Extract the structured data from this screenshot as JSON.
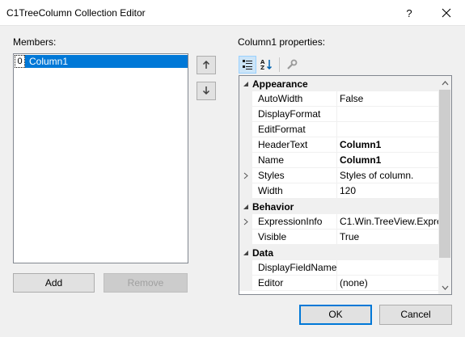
{
  "window": {
    "title": "C1TreeColumn Collection Editor",
    "help_glyph": "?",
    "close_glyph": "✕"
  },
  "members": {
    "label": "Members:",
    "items": [
      {
        "index": "0",
        "name": "Column1",
        "selected": true
      }
    ],
    "up_icon": "arrow-up-icon",
    "down_icon": "arrow-down-icon",
    "add_label": "Add",
    "remove_label": "Remove"
  },
  "properties": {
    "label": "Column1 properties:",
    "toolbar": [
      "categorized-icon",
      "alphabetical-icon",
      "property-pages-icon"
    ],
    "categories": [
      {
        "name": "Appearance",
        "rows": [
          {
            "name": "AutoWidth",
            "value": "False",
            "expandable": false,
            "bold": false
          },
          {
            "name": "DisplayFormat",
            "value": "",
            "expandable": false,
            "bold": false
          },
          {
            "name": "EditFormat",
            "value": "",
            "expandable": false,
            "bold": false
          },
          {
            "name": "HeaderText",
            "value": "Column1",
            "expandable": false,
            "bold": true
          },
          {
            "name": "Name",
            "value": "Column1",
            "expandable": false,
            "bold": true
          },
          {
            "name": "Styles",
            "value": "Styles of column.",
            "expandable": true,
            "bold": false
          },
          {
            "name": "Width",
            "value": "120",
            "expandable": false,
            "bold": false
          }
        ]
      },
      {
        "name": "Behavior",
        "rows": [
          {
            "name": "ExpressionInfo",
            "value": "C1.Win.TreeView.Expres",
            "expandable": true,
            "bold": false
          },
          {
            "name": "Visible",
            "value": "True",
            "expandable": false,
            "bold": false
          }
        ]
      },
      {
        "name": "Data",
        "rows": [
          {
            "name": "DisplayFieldName",
            "value": "",
            "expandable": false,
            "bold": false
          },
          {
            "name": "Editor",
            "value": "(none)",
            "expandable": false,
            "bold": false
          }
        ]
      }
    ]
  },
  "buttons": {
    "ok": "OK",
    "cancel": "Cancel"
  },
  "colors": {
    "selection": "#0078d7",
    "dialog_bg": "#f0f0f0",
    "button_bg": "#e1e1e1"
  }
}
